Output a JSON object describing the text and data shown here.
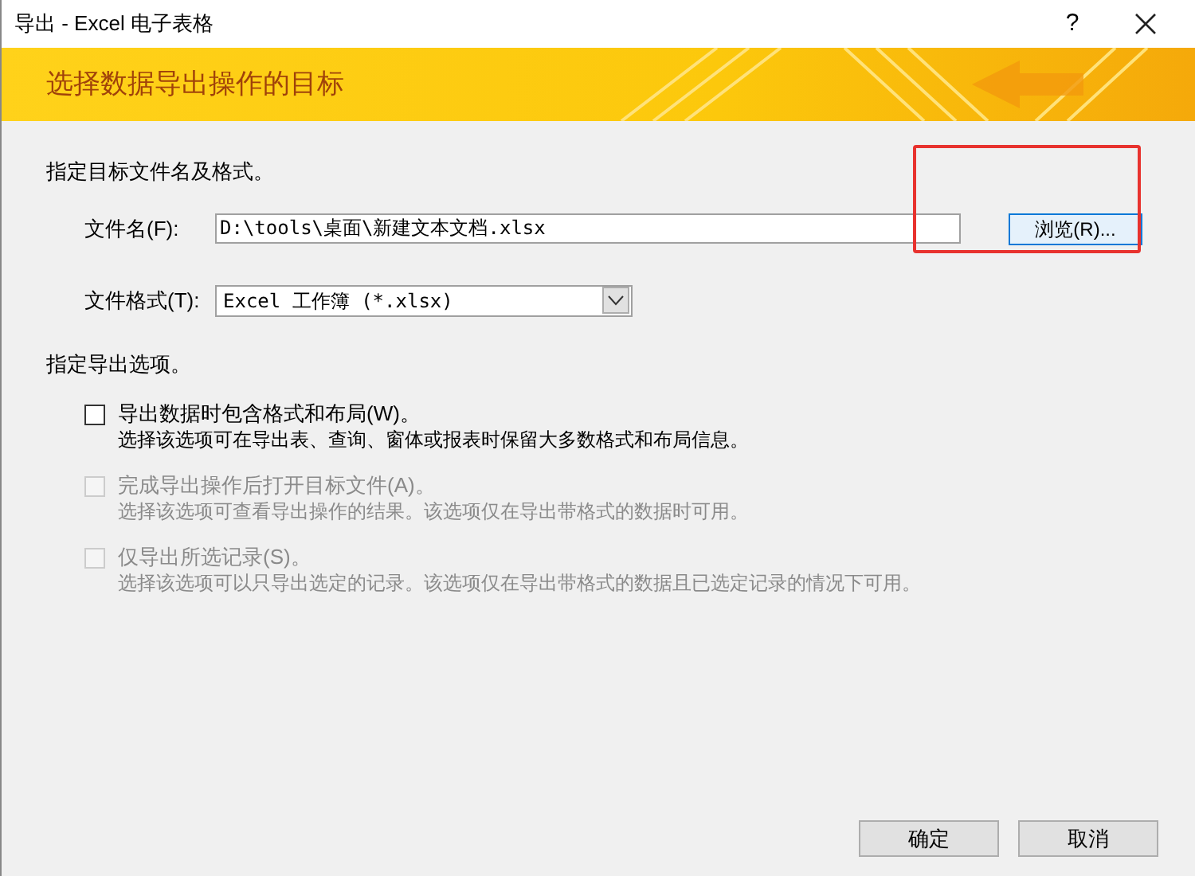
{
  "window": {
    "title": "导出 - Excel 电子表格",
    "help": "?"
  },
  "banner": {
    "title": "选择数据导出操作的目标"
  },
  "target": {
    "heading": "指定目标文件名及格式。",
    "file_label": "文件名(F):",
    "file_value": "D:\\tools\\桌面\\新建文本文档.xlsx",
    "browse": "浏览(R)...",
    "format_label": "文件格式(T):",
    "format_value": "Excel 工作簿 (*.xlsx)"
  },
  "options_heading": "指定导出选项。",
  "options": [
    {
      "label": "导出数据时包含格式和布局(W)。",
      "description": "选择该选项可在导出表、查询、窗体或报表时保留大多数格式和布局信息。",
      "checked": false,
      "disabled": false
    },
    {
      "label": "完成导出操作后打开目标文件(A)。",
      "description": "选择该选项可查看导出操作的结果。该选项仅在导出带格式的数据时可用。",
      "checked": false,
      "disabled": true
    },
    {
      "label": "仅导出所选记录(S)。",
      "description": "选择该选项可以只导出选定的记录。该选项仅在导出带格式的数据且已选定记录的情况下可用。",
      "checked": false,
      "disabled": true
    }
  ],
  "buttons": [
    "确定",
    "取消"
  ]
}
